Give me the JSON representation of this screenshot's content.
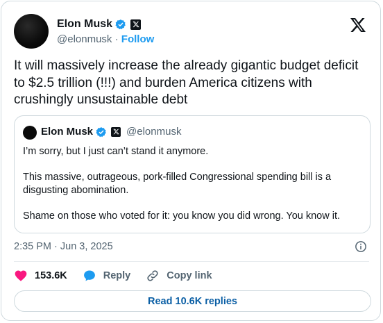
{
  "author": {
    "name": "Elon Musk",
    "handle": "@elonmusk",
    "follow_label": "Follow"
  },
  "tweet": {
    "text": "It will massively increase the already gigantic budget deficit to $2.5 trillion (!!!) and burden America citizens with crushingly unsustainable debt"
  },
  "quote": {
    "name": "Elon Musk",
    "handle": "@elonmusk",
    "paragraphs": [
      "I’m sorry, but I just can’t stand it anymore.",
      "This massive, outrageous, pork-filled Congressional spending bill is a disgusting abomination.",
      "Shame on those who voted for it: you know you did wrong. You know it."
    ]
  },
  "meta": {
    "timestamp": "2:35 PM · Jun 3, 2025"
  },
  "actions": {
    "likes": "153.6K",
    "reply_label": "Reply",
    "copy_link_label": "Copy link"
  },
  "replies_button": "Read 10.6K replies",
  "colors": {
    "accent": "#1d9bf0",
    "like": "#f91880",
    "text": "#0f1419",
    "muted": "#536471",
    "border": "#cfd9de"
  }
}
